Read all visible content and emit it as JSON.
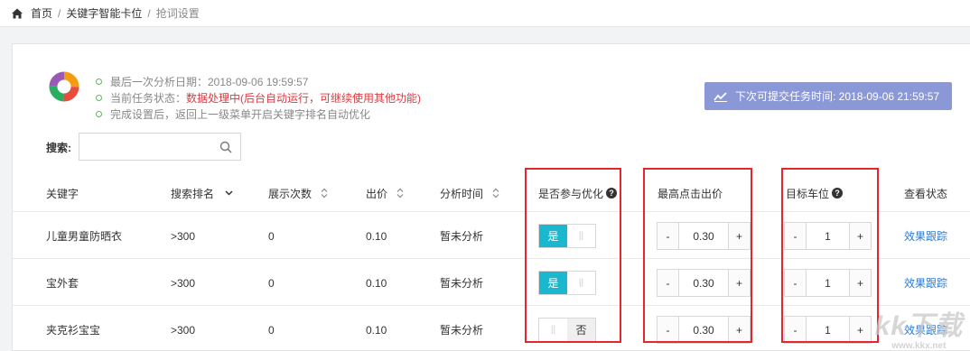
{
  "breadcrumb": {
    "items": [
      "首页",
      "关键字智能卡位"
    ],
    "current": "抢词设置",
    "separator": "/"
  },
  "info": {
    "last_analysis": "最后一次分析日期：2018-09-06 19:59:57",
    "task_status_label": "当前任务状态：",
    "task_status_value": "数据处理中(后台自动运行，可继续使用其他功能)",
    "tip": "完成设置后，返回上一级菜单开启关键字排名自动优化"
  },
  "next_submit": "下次可提交任务时间: 2018-09-06 21:59:57",
  "search": {
    "label": "搜索:",
    "value": "",
    "placeholder": ""
  },
  "table": {
    "headers": {
      "keyword": "关键字",
      "rank": "搜索排名",
      "impressions": "展示次数",
      "bid": "出价",
      "analysis_time": "分析时间",
      "participate": "是否参与优化",
      "max_bid": "最高点击出价",
      "target_slot": "目标车位",
      "view_status": "查看状态"
    },
    "rows": [
      {
        "keyword": "儿童男童防晒衣",
        "rank": ">300",
        "impressions": "0",
        "bid": "0.10",
        "analysis_time": "暂未分析",
        "participate": "是",
        "max_bid": "0.30",
        "target_slot": "1",
        "view_link": "效果跟踪"
      },
      {
        "keyword": "宝外套",
        "rank": ">300",
        "impressions": "0",
        "bid": "0.10",
        "analysis_time": "暂未分析",
        "participate": "是",
        "max_bid": "0.30",
        "target_slot": "1",
        "view_link": "效果跟踪"
      },
      {
        "keyword": "夹克衫宝宝",
        "rank": ">300",
        "impressions": "0",
        "bid": "0.10",
        "analysis_time": "暂未分析",
        "participate": "否",
        "max_bid": "0.30",
        "target_slot": "1",
        "view_link": "效果跟踪"
      }
    ]
  },
  "stepper": {
    "minus": "-",
    "plus": "+"
  },
  "toggle": {
    "on_label": "是",
    "off_label": "否",
    "blank_mark": "||"
  },
  "help_mark": "?",
  "watermark": {
    "logo": "kk下载",
    "url": "www.kkx.net"
  },
  "colors": {
    "accent": "#1ab7cf",
    "danger": "#e0393e",
    "link": "#2a7ad6",
    "submit_bg": "#8b98d8",
    "highlight": "#e5262c",
    "status_dot": "#5cb85c"
  }
}
